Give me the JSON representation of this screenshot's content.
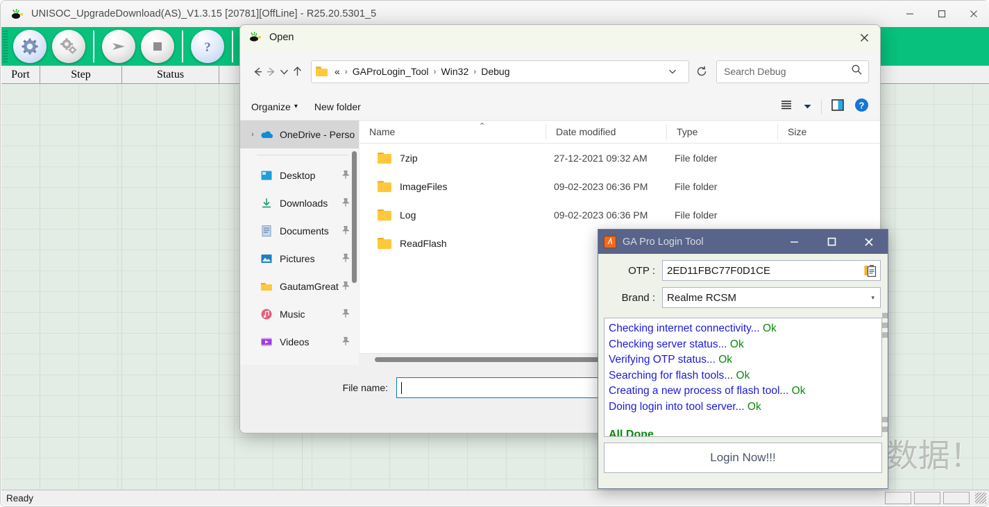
{
  "main_window": {
    "title": "UNISOC_UpgradeDownload(AS)_V1.3.15 [20781][OffLine] - R25.20.5301_5",
    "window_controls": {
      "minimize": "—",
      "maximize": "☐",
      "close": "✕"
    },
    "toolbar": {
      "buttons": [
        {
          "name": "settings-button",
          "icon": "gear-icon"
        },
        {
          "name": "config-button",
          "icon": "gears-icon"
        },
        {
          "name": "start-button",
          "icon": "play-arrow-icon"
        },
        {
          "name": "stop-button",
          "icon": "stop-square-icon"
        },
        {
          "name": "help-button",
          "icon": "question-mark-icon"
        }
      ]
    },
    "grid": {
      "columns": [
        "Port",
        "Step",
        "Status",
        ""
      ]
    },
    "watermark": "数据！",
    "statusbar": {
      "text": "Ready"
    },
    "accent_green": "#07c17c"
  },
  "open_dialog": {
    "title": "Open",
    "close_label": "✕",
    "nav": {
      "back": "←",
      "forward": "→",
      "recent": "∨",
      "up": "↑",
      "refresh": "↻",
      "dropdown": "∨"
    },
    "breadcrumbs": [
      "«",
      "GAProLogin_Tool",
      "Win32",
      "Debug"
    ],
    "breadcrumb_separator": "›",
    "search": {
      "placeholder": "Search Debug",
      "value": "",
      "icon": "search-icon"
    },
    "commands": {
      "organize": "Organize",
      "organize_caret": "▾",
      "new_folder": "New folder",
      "view_icon": "list-view-icon",
      "view_caret": "▾",
      "pane_icon": "preview-pane-icon",
      "help_icon": "help-circle-icon"
    },
    "sidebar": {
      "items": [
        {
          "label": "OneDrive - Perso",
          "icon": "onedrive-icon",
          "chevron": "›",
          "pinned": false,
          "selected": true
        },
        {
          "label": "Desktop",
          "icon": "desktop-icon",
          "pinned": true,
          "selected": false
        },
        {
          "label": "Downloads",
          "icon": "downloads-icon",
          "pinned": true,
          "selected": false
        },
        {
          "label": "Documents",
          "icon": "documents-icon",
          "pinned": true,
          "selected": false
        },
        {
          "label": "Pictures",
          "icon": "pictures-icon",
          "pinned": true,
          "selected": false
        },
        {
          "label": "GautamGreat",
          "icon": "folder-icon",
          "pinned": true,
          "selected": false
        },
        {
          "label": "Music",
          "icon": "music-icon",
          "pinned": true,
          "selected": false
        },
        {
          "label": "Videos",
          "icon": "videos-icon",
          "pinned": true,
          "selected": false
        }
      ],
      "pin_glyph": "📌"
    },
    "file_list": {
      "columns": [
        "Name",
        "Date modified",
        "Type",
        "Size"
      ],
      "sort_caret": "⌃",
      "rows": [
        {
          "name": "7zip",
          "date_modified": "27-12-2021 09:32 AM",
          "type": "File folder",
          "size": ""
        },
        {
          "name": "ImageFiles",
          "date_modified": "09-02-2023 06:36 PM",
          "type": "File folder",
          "size": ""
        },
        {
          "name": "Log",
          "date_modified": "09-02-2023 06:36 PM",
          "type": "File folder",
          "size": ""
        },
        {
          "name": "ReadFlash",
          "date_modified": "",
          "type": "",
          "size": ""
        }
      ]
    },
    "footer": {
      "file_name_label": "File name:",
      "file_name_value": "",
      "file_name_placeholder": ""
    }
  },
  "ga_tool": {
    "title": "GA Pro Login Tool",
    "icon_letter": "🖹",
    "controls": {
      "minimize": "─",
      "maximize": "☐",
      "close": "✕"
    },
    "otp": {
      "label": "OTP :",
      "value": "2ED11FBC77F0D1CE",
      "paste_icon": "clipboard-icon"
    },
    "brand": {
      "label": "Brand :",
      "value": "Realme RCSM",
      "caret": "▾"
    },
    "log_lines": [
      {
        "text": "Checking internet connectivity...",
        "status": "Ok"
      },
      {
        "text": "Checking server status...",
        "status": "Ok"
      },
      {
        "text": "Verifying OTP status...",
        "status": "Ok"
      },
      {
        "text": "Searching for flash tools...",
        "status": "Ok"
      },
      {
        "text": "Creating a new process of flash tool...",
        "status": "Ok"
      },
      {
        "text": "Doing login into tool server...",
        "status": "Ok"
      }
    ],
    "all_done": "All Done",
    "login_button": "Login Now!!!",
    "colors": {
      "titlebar": "#59648a",
      "log_text": "#1a1ae0",
      "log_ok": "#0a8a0a"
    }
  }
}
